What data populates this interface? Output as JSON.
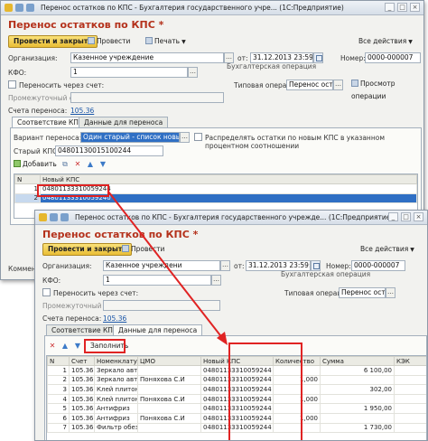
{
  "window1": {
    "title": "Перенос остатков по КПС - Бухгалтерия государственного учре...  (1С:Предприятие)",
    "doc_title": "Перенос остатков по КПС *",
    "toolbar": {
      "post_close": "Провести и закрыть",
      "post": "Провести",
      "print": "Печать",
      "all_actions": "Все действия"
    },
    "labels": {
      "org": "Организация:",
      "from": "от:",
      "number": "Номер:",
      "kfo": "КФО:",
      "accounting_op": "Бухгалтерская операция",
      "transfer_via": "Переносить через счет:",
      "typical_op": "Типовая операция:",
      "intermediate": "Промежуточный счет:",
      "transfer_accounts": "Счета переноса:",
      "variant": "Вариант переноса:",
      "distribute": "Распределять остатки по новым КПС в указанном процентном соотношении",
      "old_kps": "Старый КПС:"
    },
    "values": {
      "org": "Казенное учреждение",
      "date": "31.12.2013 23:59:59",
      "number": "0000-000007",
      "kfo": "1",
      "typical_op": "Перенос остатк",
      "view_op": "Просмотр операции",
      "transfer_accounts": "105.36",
      "variant": "Один старый - список новых",
      "old_kps": "04801130015100244"
    },
    "tabs": [
      "Соответствие КПС",
      "Данные для переноса"
    ],
    "add_button": "Добавить",
    "grid": {
      "columns": [
        "N",
        "Новый КПС"
      ],
      "rows": [
        {
          "n": "1",
          "kps": "04801133310059244"
        },
        {
          "n": "2",
          "kps": "04801133310059240"
        }
      ]
    },
    "comment_label": "Коммен"
  },
  "window2": {
    "title": "Перенос остатков по КПС - Бухгалтерия государственного учрежде...  (1С:Предприятие)",
    "doc_title": "Перенос остатков по КПС *",
    "toolbar": {
      "post_close": "Провести и закрыть",
      "post": "Провести",
      "all_actions": "Все действия"
    },
    "labels": {
      "org": "Организация:",
      "from": "от:",
      "number": "Номер:",
      "kfo": "КФО:",
      "accounting_op": "Бухгалтерская операция",
      "transfer_via": "Переносить через счет:",
      "typical_op": "Типовая операция:",
      "intermediate": "Промежуточный счет:",
      "transfer_accounts": "Счета переноса:"
    },
    "values": {
      "org": "Казенное учреждени",
      "date": "31.12.2013 23:59:59",
      "number": "0000-000007",
      "kfo": "1",
      "typical_op": "Перенос остатк",
      "transfer_accounts": "105.36"
    },
    "tabs": [
      "Соответствие КПС",
      "Данные для переноса"
    ],
    "fill_button": "Заполнить",
    "grid": {
      "columns": [
        "N",
        "Счет",
        "Номенклатура",
        "ЦМО",
        "Новый КПС",
        "Количество",
        "Сумма",
        "КЭК"
      ],
      "rows": [
        {
          "n": "1",
          "acc": "105.36",
          "item": "Зеркало автомоби...",
          "cmo": "",
          "kps": "04801133310059244",
          "qty": "",
          "sum": "6 100,00",
          "kek": ""
        },
        {
          "n": "2",
          "acc": "105.36",
          "item": "Зеркало автомоби...",
          "cmo": "Поняхова С.И",
          "kps": "04801133310059244",
          "qty": "1,000",
          "sum": "",
          "kek": ""
        },
        {
          "n": "3",
          "acc": "105.36",
          "item": "Клей плитонит",
          "cmo": "",
          "kps": "04801133310059244",
          "qty": "",
          "sum": "302,00",
          "kek": ""
        },
        {
          "n": "4",
          "acc": "105.36",
          "item": "Клей плитонит",
          "cmo": "Поняхова С.И",
          "kps": "04801133310059244",
          "qty": "1,000",
          "sum": "",
          "kek": ""
        },
        {
          "n": "5",
          "acc": "105.36",
          "item": "Антифриз",
          "cmo": "",
          "kps": "04801133310059244",
          "qty": "",
          "sum": "1 950,00",
          "kek": ""
        },
        {
          "n": "6",
          "acc": "105.36",
          "item": "Антифриз",
          "cmo": "Поняхова С.И",
          "kps": "04801133310059244",
          "qty": "1,000",
          "sum": "",
          "kek": ""
        },
        {
          "n": "7",
          "acc": "105.36",
          "item": "Фильтр обезвозд...",
          "cmo": "",
          "kps": "04801133310059244",
          "qty": "",
          "sum": "1 730,00",
          "kek": ""
        }
      ]
    }
  }
}
